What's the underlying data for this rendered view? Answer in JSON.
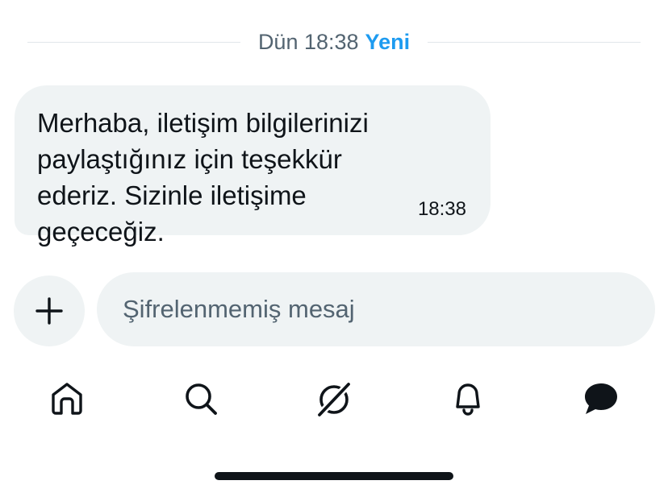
{
  "conversation": {
    "date_label": "Dün 18:38",
    "new_label": "Yeni",
    "messages": [
      {
        "text": "Merhaba, iletişim bilgilerinizi paylaştığınız için teşekkür ederiz. Sizinle iletişime geçeceğiz.",
        "time": "18:38"
      }
    ]
  },
  "composer": {
    "placeholder": "Şifrelenmemiş mesaj"
  },
  "nav": {
    "items": [
      {
        "icon": "home-icon"
      },
      {
        "icon": "search-icon"
      },
      {
        "icon": "grok-icon"
      },
      {
        "icon": "bell-icon"
      },
      {
        "icon": "messages-icon",
        "active": true
      }
    ]
  },
  "colors": {
    "accent": "#1d9bf0",
    "text": "#0f1419",
    "muted": "#536471",
    "bubble_bg": "#eff3f4"
  }
}
